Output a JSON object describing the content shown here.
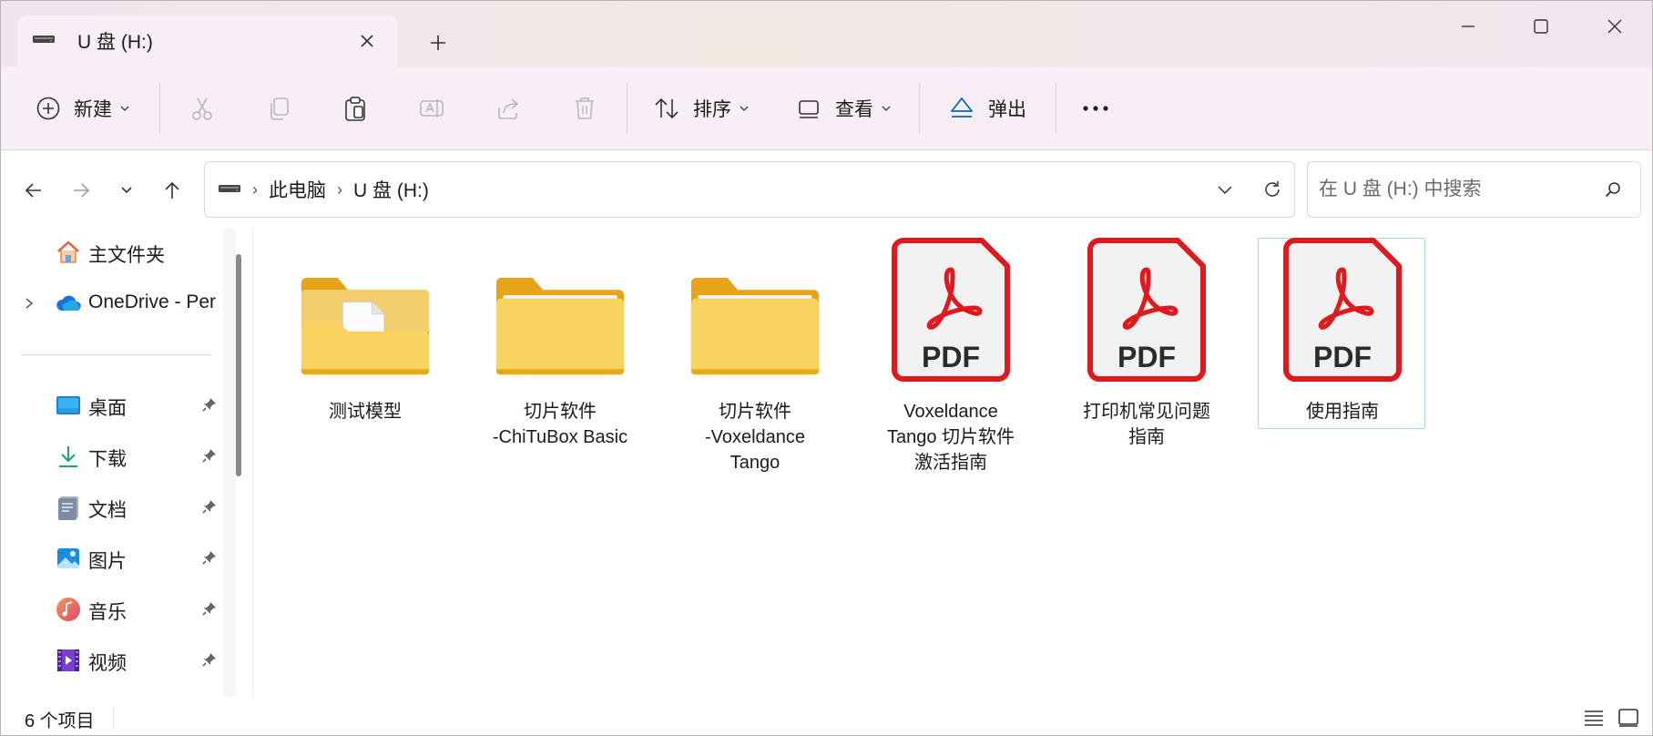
{
  "window": {
    "tab_title": "U 盘 (H:)",
    "new_tab_label": "+"
  },
  "colors": {
    "accent": "#0067c0",
    "pdf_red": "#e0191f",
    "folder_yellow": "#f8d360"
  },
  "toolbar": {
    "new_label": "新建",
    "sort_label": "排序",
    "view_label": "查看",
    "eject_label": "弹出",
    "icons": [
      "plus-circle-icon",
      "cut-icon",
      "copy-icon",
      "paste-icon",
      "rename-icon",
      "share-icon",
      "delete-icon",
      "sort-icon",
      "view-icon",
      "eject-icon",
      "more-icon"
    ]
  },
  "address": {
    "crumbs": [
      "此电脑",
      "U 盘 (H:)"
    ],
    "search_placeholder": "在 U 盘 (H:) 中搜索"
  },
  "sidebar": {
    "items": [
      {
        "label": "主文件夹",
        "icon": "home-icon",
        "pinned": false
      },
      {
        "label": "OneDrive - Per",
        "icon": "onedrive-icon",
        "pinned": false,
        "expandable": true
      },
      {
        "label": "桌面",
        "icon": "desktop-icon",
        "pinned": true
      },
      {
        "label": "下载",
        "icon": "download-icon",
        "pinned": true
      },
      {
        "label": "文档",
        "icon": "documents-icon",
        "pinned": true
      },
      {
        "label": "图片",
        "icon": "pictures-icon",
        "pinned": true
      },
      {
        "label": "音乐",
        "icon": "music-icon",
        "pinned": true
      },
      {
        "label": "视频",
        "icon": "videos-icon",
        "pinned": true
      }
    ]
  },
  "files": [
    {
      "name": "测试模型",
      "type": "folder-with-file",
      "selected": false
    },
    {
      "name": "切片软件\n-ChiTuBox Basic",
      "type": "folder",
      "selected": false
    },
    {
      "name": "切片软件\n-Voxeldance\nTango",
      "type": "folder",
      "selected": false
    },
    {
      "name": "Voxeldance\nTango 切片软件\n激活指南",
      "type": "pdf",
      "selected": false
    },
    {
      "name": "打印机常见问题\n指南",
      "type": "pdf",
      "selected": false
    },
    {
      "name": "使用指南",
      "type": "pdf",
      "selected": true
    }
  ],
  "pdf_badge": "PDF",
  "status": {
    "item_count": "6 个项目"
  }
}
